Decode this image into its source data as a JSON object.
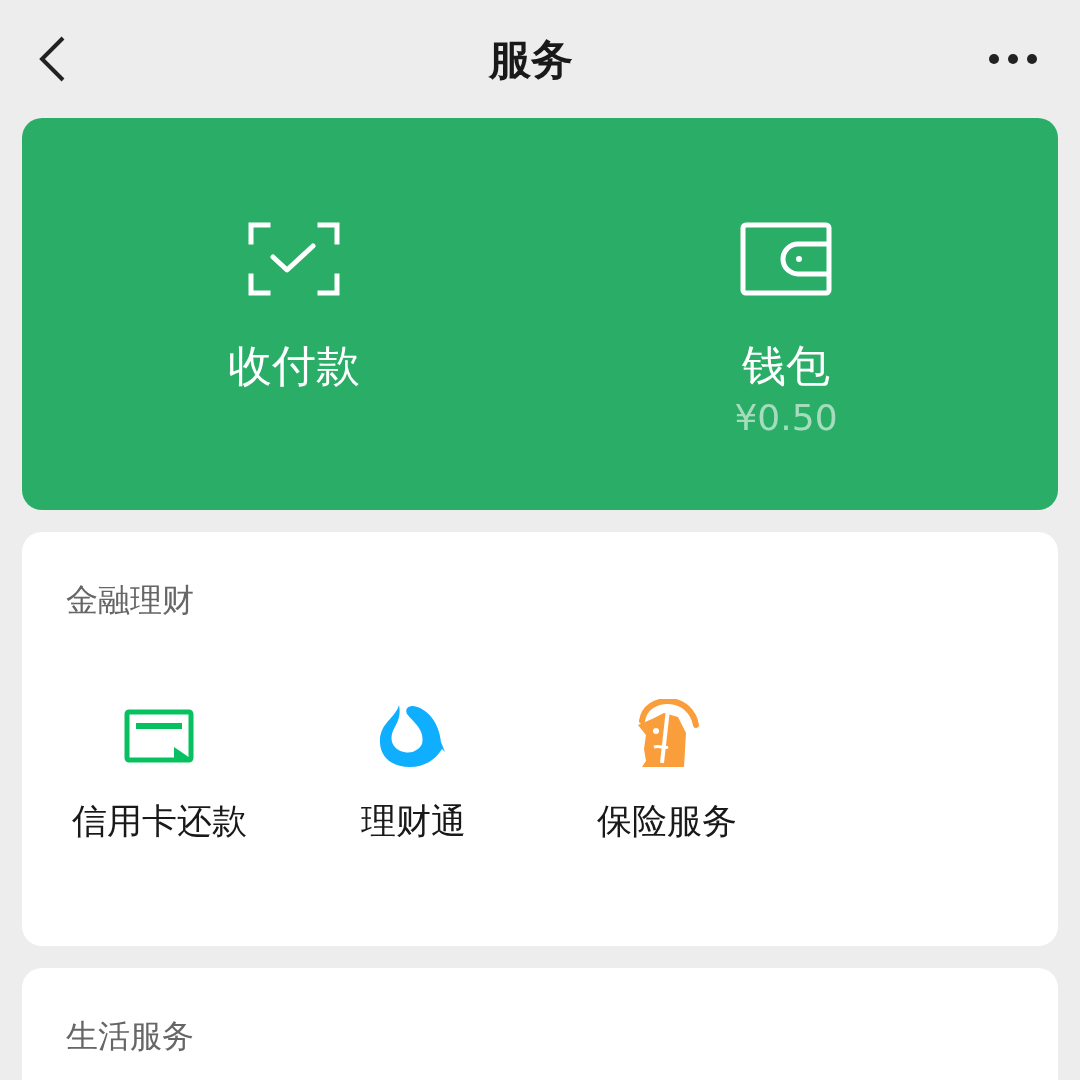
{
  "header": {
    "title": "服务"
  },
  "wallet_panel": {
    "items": [
      {
        "kind": "pay",
        "label": "收付款"
      },
      {
        "kind": "wallet",
        "label": "钱包",
        "amount": "¥0.50"
      }
    ]
  },
  "sections": [
    {
      "title": "金融理财",
      "items": [
        {
          "kind": "card",
          "label": "信用卡还款"
        },
        {
          "kind": "fund",
          "label": "理财通"
        },
        {
          "kind": "insurance",
          "label": "保险服务"
        }
      ]
    },
    {
      "title": "生活服务"
    }
  ]
}
